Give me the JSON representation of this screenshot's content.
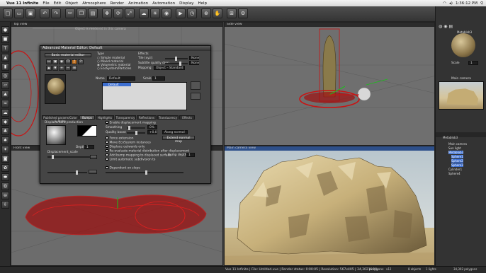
{
  "menubar": {
    "apple": "",
    "app_name": "Vue 11 Infinite",
    "items": [
      "File",
      "Edit",
      "Object",
      "Atmosphere",
      "Render",
      "Animation",
      "Automation",
      "Display",
      "Help"
    ],
    "window_title": "Vue 11.5 Infinite – Untitled",
    "clock": "1:36:12 PM"
  },
  "viewports": {
    "top": "Top view",
    "side": "Side view",
    "front": "Front view",
    "main": "Main camera view",
    "hidden_label": "Object is rendered in this camera"
  },
  "dialog": {
    "title": "Advanced Material Editor: Default",
    "basic_button": "Basic material editor",
    "type_header": "Type",
    "types": [
      "Simple material",
      "Mixed material",
      "Volumetric material",
      "EcoSystem/Particles"
    ],
    "effects_header": "Effects",
    "effects": [
      {
        "label": "Tile (xyz):",
        "value": "None"
      },
      {
        "label": "Subtitle quality drop",
        "value": "None"
      },
      {
        "label": "Mapping:",
        "value": "Object – Standard"
      }
    ],
    "name_label": "Name",
    "name_value": "Default",
    "scale_label": "Scale",
    "scale_value": "1",
    "list_item": "Default",
    "tabs": [
      "Published params/Color & Alpha",
      "Bumps",
      "Highlights",
      "Transparency",
      "Reflections",
      "Translucency",
      "Effects"
    ],
    "displacement_header": "Displacement production",
    "displacement_mapping": "Enable displacement mapping",
    "smoothing_label": "Smoothing",
    "smoothing_value": "0%",
    "quality_label": "Quality boost",
    "quality_value": "+0.0",
    "quality_option": "Along normal",
    "extend_button": "Extend normal map",
    "options": [
      "Force extension",
      "Move EcoSystem instances",
      "Displace outwards only",
      "Re-evaluate material distribution after displacement",
      "Add bump mapping to displaced surface",
      "Limit automatic subdivision to"
    ],
    "bump_depth_label": "Bump depth",
    "bump_depth_value": "1",
    "depth_label": "Depth",
    "depth_value": "1",
    "scale2_label": "Displacement_scale",
    "dependent_label": "Dependent on slope"
  },
  "right_panel": {
    "material_name": "Metablob3",
    "scale_label": "Scale",
    "scale_value": "1",
    "camera_label": "Main camera",
    "object_header": "Metablob3",
    "tree": [
      {
        "label": "Main camera",
        "selected": false
      },
      {
        "label": "Sun light",
        "selected": false
      },
      {
        "label": "Metablob3",
        "selected": true
      },
      {
        "label": "Sphere1",
        "selected": true
      },
      {
        "label": "Sphere2",
        "selected": true
      },
      {
        "label": "Sphere3",
        "selected": true
      },
      {
        "label": "Cylinder1",
        "selected": false
      },
      {
        "label": "Sphere4",
        "selected": false
      }
    ]
  },
  "status": {
    "text": "Vue 11 Infinite | File: Untitled.vue | Render status: 0:00:05 | Resolution: 567x405 | 34,302 polygons",
    "zoom": "16.0%",
    "ratio": "x12",
    "objects": "8 objects",
    "lights": "1 lights",
    "polygons": "34,302 polygons"
  },
  "colors": {
    "selection": "#3d6fd1",
    "wireframe": "#cc1111",
    "rock_light": "#d8c79a",
    "rock_dark": "#6b5a3a",
    "sky": "#cfd6db"
  }
}
